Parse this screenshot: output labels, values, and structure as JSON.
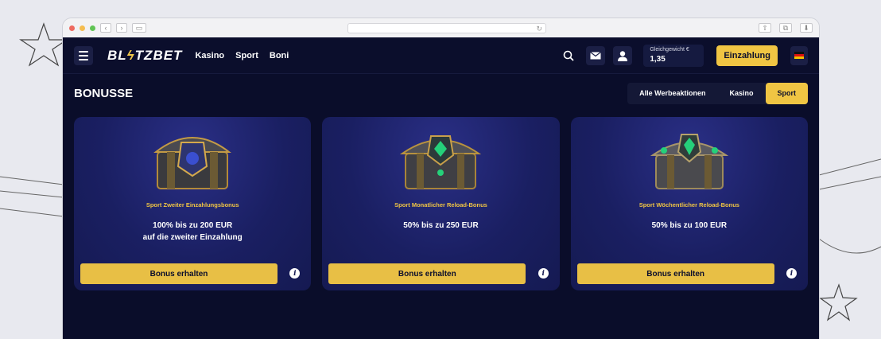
{
  "browser": {
    "colors": {
      "close": "#ee6a5f",
      "minimize": "#f5bd4f",
      "maximize": "#61c454"
    }
  },
  "header": {
    "logo": {
      "part1": "BL",
      "accent": "ϟ",
      "part2": "TZBET"
    },
    "nav": [
      "Kasino",
      "Sport",
      "Boni"
    ],
    "balance_label": "Gleichgewicht €",
    "balance_value": "1,35",
    "deposit_label": "Einzahlung",
    "icons": [
      "menu-icon",
      "search-icon",
      "mail-icon",
      "user-icon",
      "flag-de-icon"
    ]
  },
  "page": {
    "title": "BONUSSE",
    "filters": [
      "Alle Werbeaktionen",
      "Kasino",
      "Sport"
    ],
    "active_filter": "Sport"
  },
  "bonuses": [
    {
      "name": "Sport Zweiter Einzahlungsbonus",
      "line1": "100% bis zu 200 EUR",
      "line2": "auf die zweiter Einzahlung",
      "button": "Bonus erhalten",
      "gem": "#3a4fd0"
    },
    {
      "name": "Sport Monatlicher Reload-Bonus",
      "line1": "50% bis zu 250 EUR",
      "line2": "",
      "button": "Bonus erhalten",
      "gem": "#25d17a"
    },
    {
      "name": "Sport Wöchentlicher Reload-Bonus",
      "line1": "50% bis zu 100 EUR",
      "line2": "",
      "button": "Bonus erhalten",
      "gem": "#25d17a"
    }
  ],
  "colors": {
    "accent": "#f0c543",
    "background": "#0a0d2a",
    "card": "#1a1f62"
  }
}
